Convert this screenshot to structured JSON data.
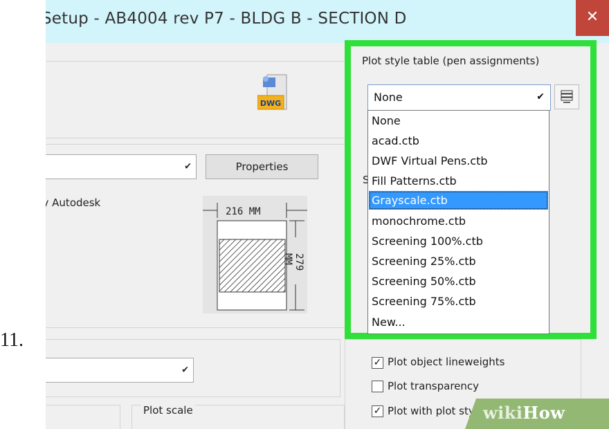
{
  "step_number": "11.",
  "window": {
    "title": "Setup - AB4004 rev P7 - BLDG B - SECTION D",
    "close_glyph": "✕"
  },
  "printer": {
    "properties_label": "Properties",
    "driver_text": "by Autodesk",
    "paper_width": "216 MM",
    "paper_height": "279 MM",
    "file_icon_label": "DWG"
  },
  "plot_scale_label": "Plot scale",
  "plot_style_table": {
    "group_label": "Plot style table (pen assignments)",
    "selected": "None",
    "options": [
      "None",
      "acad.ctb",
      "DWF Virtual Pens.ctb",
      "Fill Patterns.ctb",
      "Grayscale.ctb",
      "monochrome.ctb",
      "Screening 100%.ctb",
      "Screening 25%.ctb",
      "Screening 50%.ctb",
      "Screening 75%.ctb",
      "New..."
    ],
    "highlighted": "Grayscale.ctb",
    "hidden_label_fragment": "S"
  },
  "plot_options": {
    "items": [
      {
        "label": "Plot object lineweights",
        "checked": true
      },
      {
        "label": "Plot transparency",
        "checked": false
      },
      {
        "label": "Plot with plot styles",
        "checked": true
      }
    ]
  },
  "watermark": {
    "wiki": "wiki",
    "how": "How"
  },
  "colors": {
    "highlight_border": "#2fe03a",
    "selection": "#3399ff",
    "close_button": "#c0453a",
    "titlebar": "#d2f4fb",
    "wikihow_green": "#93b874"
  }
}
